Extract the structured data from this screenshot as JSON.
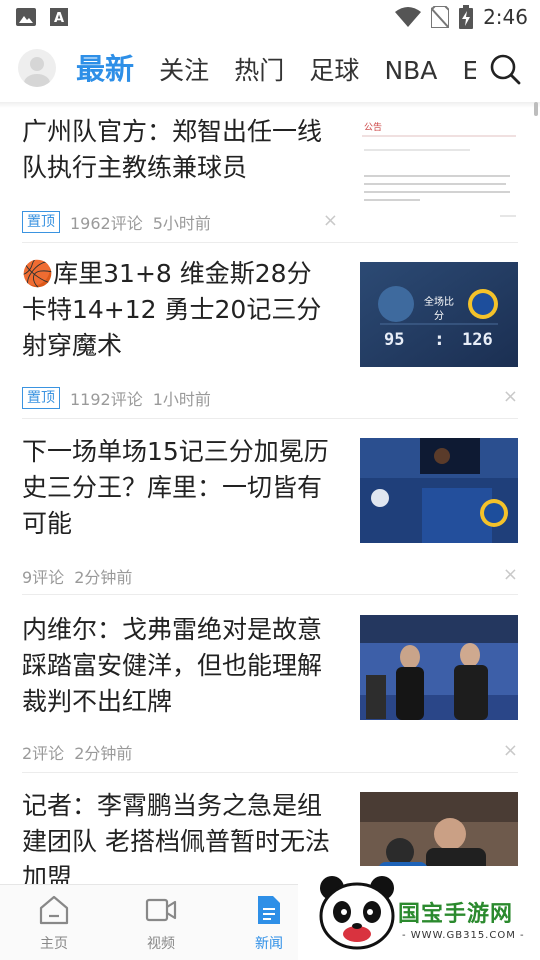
{
  "status_bar": {
    "time": "2:46",
    "icons": [
      "image-icon",
      "font-icon",
      "wifi-icon",
      "no-sim-icon",
      "battery-charging-icon"
    ]
  },
  "top_nav": {
    "avatar_icon": "user-avatar-icon",
    "tabs": [
      {
        "label": "最新",
        "active": true
      },
      {
        "label": "关注",
        "active": false
      },
      {
        "label": "热门",
        "active": false
      },
      {
        "label": "足球",
        "active": false
      },
      {
        "label": "NBA",
        "active": false
      },
      {
        "label": "E",
        "active": false
      }
    ],
    "search_icon": "search-icon",
    "accent_color": "#2e8fe7"
  },
  "feed": {
    "items": [
      {
        "title": "广州队官方：郑智出任一线队执行主教练兼球员",
        "pinned": true,
        "pin_label": "置顶",
        "comments": "1962评论",
        "time": "5小时前",
        "thumb_icon": "document-thumbnail",
        "thumb_heading": "公告"
      },
      {
        "title_emoji": "🏀",
        "title": "库里31+8 维金斯28分 卡特14+12 勇士20记三分射穿魔术",
        "pinned": true,
        "pin_label": "置顶",
        "comments": "1192评论",
        "time": "1小时前",
        "thumb_icon": "scoreboard-thumbnail",
        "thumb_score_left": "95",
        "thumb_score_right": "126",
        "thumb_caption": "全场比分"
      },
      {
        "title": "下一场单场15记三分加冕历史三分王？库里：一切皆有可能",
        "pinned": false,
        "comments": "9评论",
        "time": "2分钟前",
        "thumb_icon": "press-conference-thumbnail"
      },
      {
        "title": "内维尔：戈弗雷绝对是故意踩踏富安健洋，但也能理解裁判不出红牌",
        "pinned": false,
        "comments": "2评论",
        "time": "2分钟前",
        "thumb_icon": "stadium-photo-thumbnail"
      },
      {
        "title": "记者：李霄鹏当务之急是组建团队 老搭档佩普暂时无法加盟",
        "pinned": false,
        "thumb_icon": "hug-photo-thumbnail"
      }
    ],
    "close_glyph": "×"
  },
  "bottom_nav": {
    "items": [
      {
        "label": "主页",
        "icon": "home-icon",
        "active": false
      },
      {
        "label": "视频",
        "icon": "video-icon",
        "active": false
      },
      {
        "label": "新闻",
        "icon": "news-icon",
        "active": true
      }
    ]
  },
  "watermark": {
    "text": "国宝手游网",
    "url": "- WWW.GB315.COM -",
    "icon": "panda-logo"
  }
}
